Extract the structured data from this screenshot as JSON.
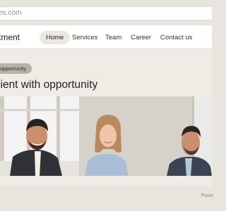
{
  "browser": {
    "url": "jes.com"
  },
  "header": {
    "brand": "tment",
    "nav": [
      {
        "label": "Home",
        "active": true
      },
      {
        "label": "Services",
        "active": false
      },
      {
        "label": "Team",
        "active": false
      },
      {
        "label": "Career",
        "active": false
      },
      {
        "label": "Contact us",
        "active": false
      }
    ]
  },
  "hero": {
    "badge": "opportunity",
    "headline": "lient with opportunity"
  },
  "footer": {
    "text": "Powe"
  },
  "colors": {
    "page_bg": "#efece6",
    "badge_bg": "#b6b2ab",
    "active_pill": "#ebe8e1"
  }
}
